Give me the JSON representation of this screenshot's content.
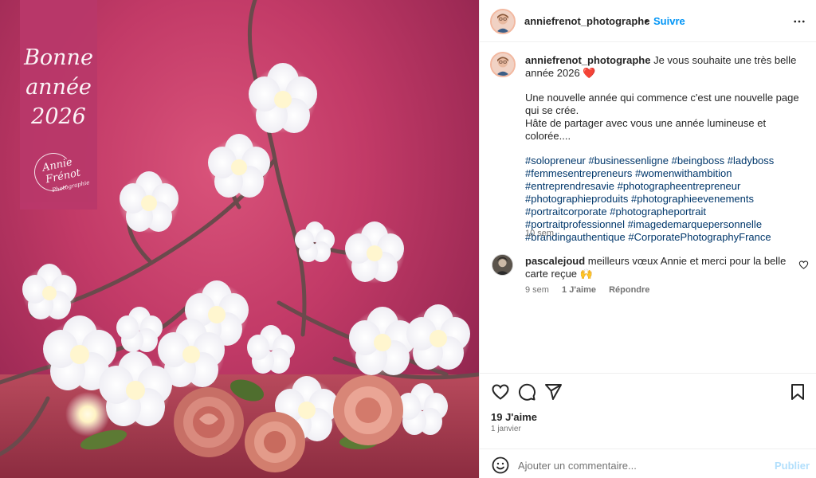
{
  "photo": {
    "greeting": [
      "Bonne",
      "année",
      "2026"
    ],
    "logo_text": [
      "Annie",
      "Frénot",
      "Photographie"
    ]
  },
  "post": {
    "username": "anniefrenot_photographe",
    "separator": "•",
    "follow_label": "Suivre",
    "caption_text": "Je vous souhaite une très belle année 2026",
    "caption_emoji": "❤️",
    "paragraph": [
      "Une nouvelle année qui commence c'est une nouvelle page",
      "qui se crée.",
      "Hâte de partager avec vous une année lumineuse et colorée...."
    ],
    "hashtags": [
      "#solopreneur",
      "#businessenligne",
      "#beingboss",
      "#ladyboss",
      "#femmesentrepreneurs",
      "#womenwithambition",
      "#entreprendresavie",
      "#photographeentrepreneur",
      "#photographieproduits",
      "#photographieevenements",
      "#portraitcorporate",
      "#photographeportrait",
      "#portraitprofessionnel",
      "#imagedemarquepersonnelle",
      "#brandingauthentique",
      "#CorporatePhotographyFrance"
    ],
    "caption_age": "10 sem"
  },
  "comment": {
    "username": "pascalejoud",
    "text": "meilleurs vœux Annie et merci pour la belle carte reçue 🙌",
    "age": "9 sem",
    "likes": "1 J'aime",
    "reply_label": "Répondre"
  },
  "footer": {
    "likes": "19 J'aime",
    "date": "1 janvier",
    "comment_placeholder": "Ajouter un commentaire...",
    "publish_label": "Publier"
  },
  "icons": [
    "more-icon",
    "heart-icon",
    "comment-icon",
    "share-icon",
    "bookmark-icon",
    "emoji-icon"
  ],
  "colors": {
    "accent": "#0095f6",
    "link": "#00376b",
    "muted": "#737373",
    "publish_disabled": "#b2dffc",
    "card": "#b9386a"
  }
}
